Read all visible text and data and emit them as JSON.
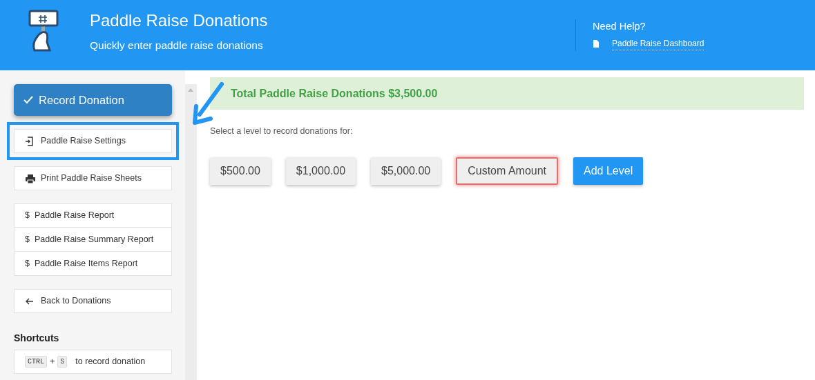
{
  "header": {
    "title": "Paddle Raise Donations",
    "subtitle": "Quickly enter paddle raise donations"
  },
  "help": {
    "title": "Need Help?",
    "link": "Paddle Raise Dashboard"
  },
  "sidebar": {
    "primary_button": "Record Donation",
    "groups": [
      [
        {
          "label": "Paddle Raise Settings",
          "kind": "login",
          "highlighted": true
        }
      ],
      [
        {
          "label": "Print Paddle Raise Sheets",
          "kind": "print",
          "highlighted": false
        }
      ],
      [
        {
          "label": "Paddle Raise Report",
          "kind": "text",
          "icon_text": "$",
          "highlighted": false
        },
        {
          "label": "Paddle Raise Summary Report",
          "kind": "text",
          "icon_text": "$",
          "highlighted": false
        },
        {
          "label": "Paddle Raise Items Report",
          "kind": "text",
          "icon_text": "$",
          "highlighted": false
        }
      ],
      [
        {
          "label": "Back to Donations",
          "kind": "back",
          "highlighted": false
        }
      ]
    ],
    "shortcuts_heading": "Shortcuts",
    "shortcut": {
      "keys": [
        "CTRL",
        "S"
      ],
      "joiner": "+",
      "text": "to record donation"
    }
  },
  "annotation_arrow": true,
  "main": {
    "total": "Total Paddle Raise Donations $3,500.00",
    "prompt": "Select a level to record donations for:",
    "levels": [
      {
        "label": "$500.00",
        "kind": "level",
        "selected": false
      },
      {
        "label": "$1,000.00",
        "kind": "level",
        "selected": false
      },
      {
        "label": "$5,000.00",
        "kind": "level",
        "selected": false
      },
      {
        "label": "Custom Amount",
        "kind": "level",
        "selected": true
      },
      {
        "label": "Add Level",
        "kind": "add",
        "selected": false
      }
    ]
  }
}
